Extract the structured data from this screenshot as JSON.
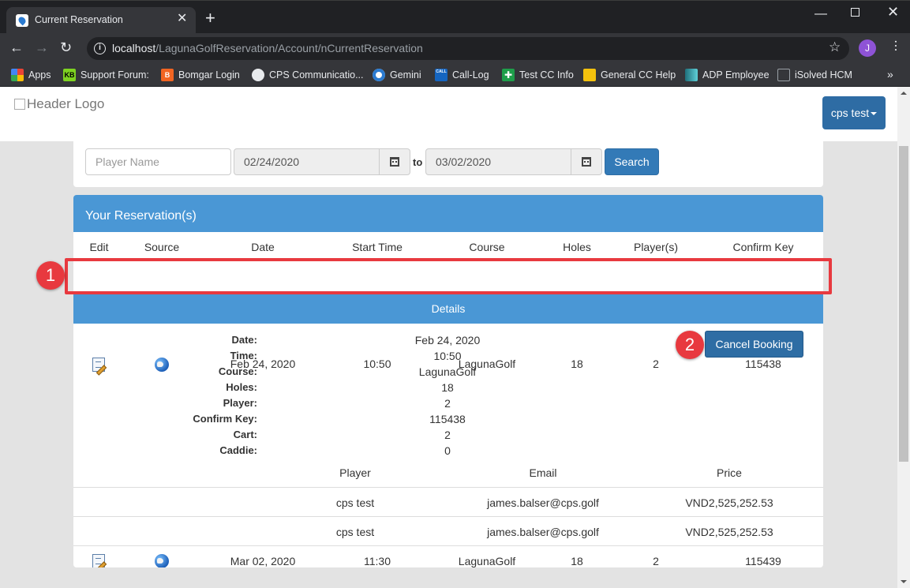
{
  "browser": {
    "tab_title": "Current Reservation",
    "tab_close": "✕",
    "new_tab": "+",
    "url_host": "localhost",
    "url_path": "/LagunaGolfReservation/Account/nCurrentReservation",
    "profile_initial": "J",
    "bookmarks": [
      {
        "label": "Apps",
        "icon": "apps-grid-icon",
        "color": "#ea4335"
      },
      {
        "label": "Support Forum:",
        "icon": "kb-icon",
        "color": "#7ed321",
        "glyph": "KB"
      },
      {
        "label": "Bomgar Login",
        "icon": "bomgar-icon",
        "color": "#f26522",
        "glyph": "B"
      },
      {
        "label": "CPS Communicatio...",
        "icon": "globe-icon",
        "color": "#ffffff"
      },
      {
        "label": "Gemini",
        "icon": "gemini-icon",
        "color": "#2b7bd1"
      },
      {
        "label": "Call-Log",
        "icon": "call-log-icon",
        "color": "#1565c0",
        "glyph": "CALL"
      },
      {
        "label": "Test CC Info",
        "icon": "plus-cross-icon",
        "color": "#1e9e4a",
        "glyph": "✚"
      },
      {
        "label": "General CC Help",
        "icon": "folder-icon",
        "color": "#f4c20d"
      },
      {
        "label": "ADP Employee",
        "icon": "adp-icon",
        "color": "#3fa9b5"
      },
      {
        "label": "iSolved HCM",
        "icon": "page-icon",
        "color": "#9aa0a6"
      }
    ],
    "bookmarks_more": "»"
  },
  "header": {
    "logo_alt": "Header Logo",
    "user_button": "cps test"
  },
  "search": {
    "player_placeholder": "Player Name",
    "date_from": "02/24/2020",
    "to_label": "to",
    "date_to": "03/02/2020",
    "search_button": "Search"
  },
  "reservations": {
    "title": "Your Reservation(s)",
    "columns": [
      "Edit",
      "Source",
      "Date",
      "Start Time",
      "Course",
      "Holes",
      "Player(s)",
      "Confirm Key"
    ],
    "rows": [
      {
        "date": "Feb 24, 2020",
        "start_time": "10:50",
        "course": "LagunaGolf",
        "holes": "18",
        "players": "2",
        "confirm_key": "115438"
      },
      {
        "date": "Mar 02, 2020",
        "start_time": "11:30",
        "course": "LagunaGolf",
        "holes": "18",
        "players": "2",
        "confirm_key": "115439"
      }
    ],
    "details_title": "Details",
    "details": [
      {
        "label": "Date:",
        "value": "Feb 24, 2020"
      },
      {
        "label": "Time:",
        "value": "10:50"
      },
      {
        "label": "Course:",
        "value": "LagunaGolf"
      },
      {
        "label": "Holes:",
        "value": "18"
      },
      {
        "label": "Player:",
        "value": "2"
      },
      {
        "label": "Confirm Key:",
        "value": "115438"
      },
      {
        "label": "Cart:",
        "value": "2"
      },
      {
        "label": "Caddie:",
        "value": "0"
      }
    ],
    "cancel_button": "Cancel Booking",
    "player_columns": [
      "Player",
      "Email",
      "Price"
    ],
    "players": [
      {
        "player": "cps test",
        "email": "james.balser@cps.golf",
        "price": "VND2,525,252.53"
      },
      {
        "player": "cps test",
        "email": "james.balser@cps.golf",
        "price": "VND2,525,252.53"
      }
    ]
  },
  "annotations": {
    "badge_1": "1",
    "badge_2": "2",
    "highlight_color": "#e8393f"
  }
}
